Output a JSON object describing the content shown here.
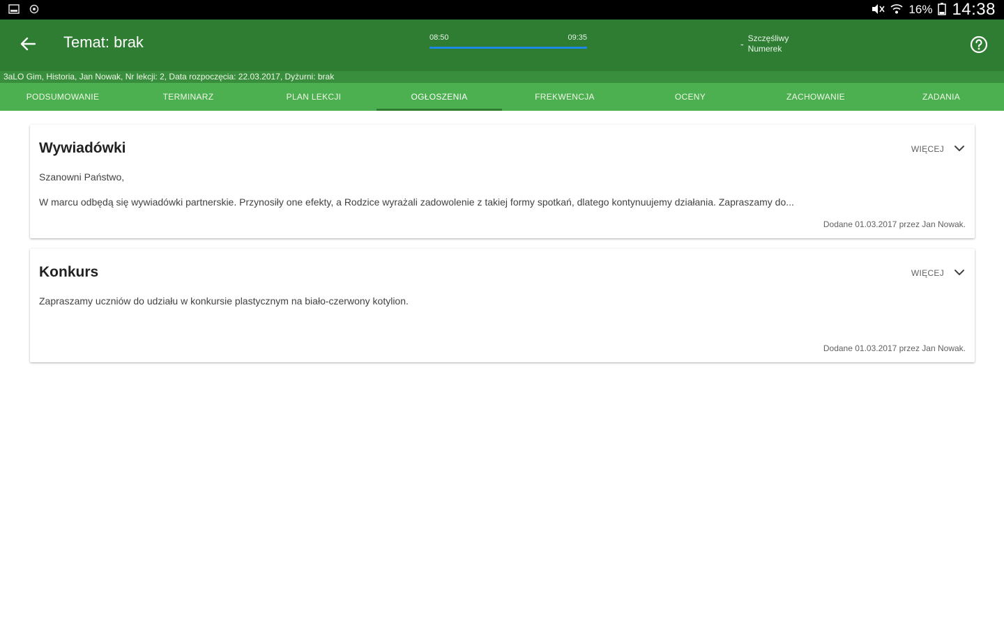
{
  "status_bar": {
    "battery_pct": "16%",
    "time": "14:38"
  },
  "app_bar": {
    "title": "Temat: brak",
    "lesson_start": "08:50",
    "lesson_end": "09:35",
    "lucky_number_value": "-",
    "lucky_number_label": "Szczęśliwy Numerek"
  },
  "info_strip": {
    "text": "3aLO Gim, Historia, Jan Nowak, Nr lekcji: 2, Data rozpoczęcia: 22.03.2017, Dyżurni: brak"
  },
  "tabs": [
    {
      "label": "PODSUMOWANIE"
    },
    {
      "label": "TERMINARZ"
    },
    {
      "label": "PLAN LEKCJI"
    },
    {
      "label": "OGŁOSZENIA"
    },
    {
      "label": "FREKWENCJA"
    },
    {
      "label": "OCENY"
    },
    {
      "label": "ZACHOWANIE"
    },
    {
      "label": "ZADANIA"
    }
  ],
  "announcements": [
    {
      "title": "Wywiadówki",
      "more_label": "WIĘCEJ",
      "greeting": "Szanowni Państwo,",
      "body": "W marcu odbędą się wywiadówki partnerskie. Przynosiły one efekty, a Rodzice wyrażali zadowolenie z takiej formy spotkań, dlatego kontynuujemy działania. Zapraszamy do...",
      "meta": "Dodane 01.03.2017 przez Jan Nowak."
    },
    {
      "title": "Konkurs",
      "more_label": "WIĘCEJ",
      "body": "Zapraszamy uczniów do udziału w konkursie plastycznym na biało-czerwony kotylion.",
      "meta": "Dodane 01.03.2017 przez Jan Nowak."
    }
  ],
  "icons": {
    "back": "arrow-left-icon",
    "help": "help-circle-icon",
    "expand": "chevron-down-icon"
  }
}
